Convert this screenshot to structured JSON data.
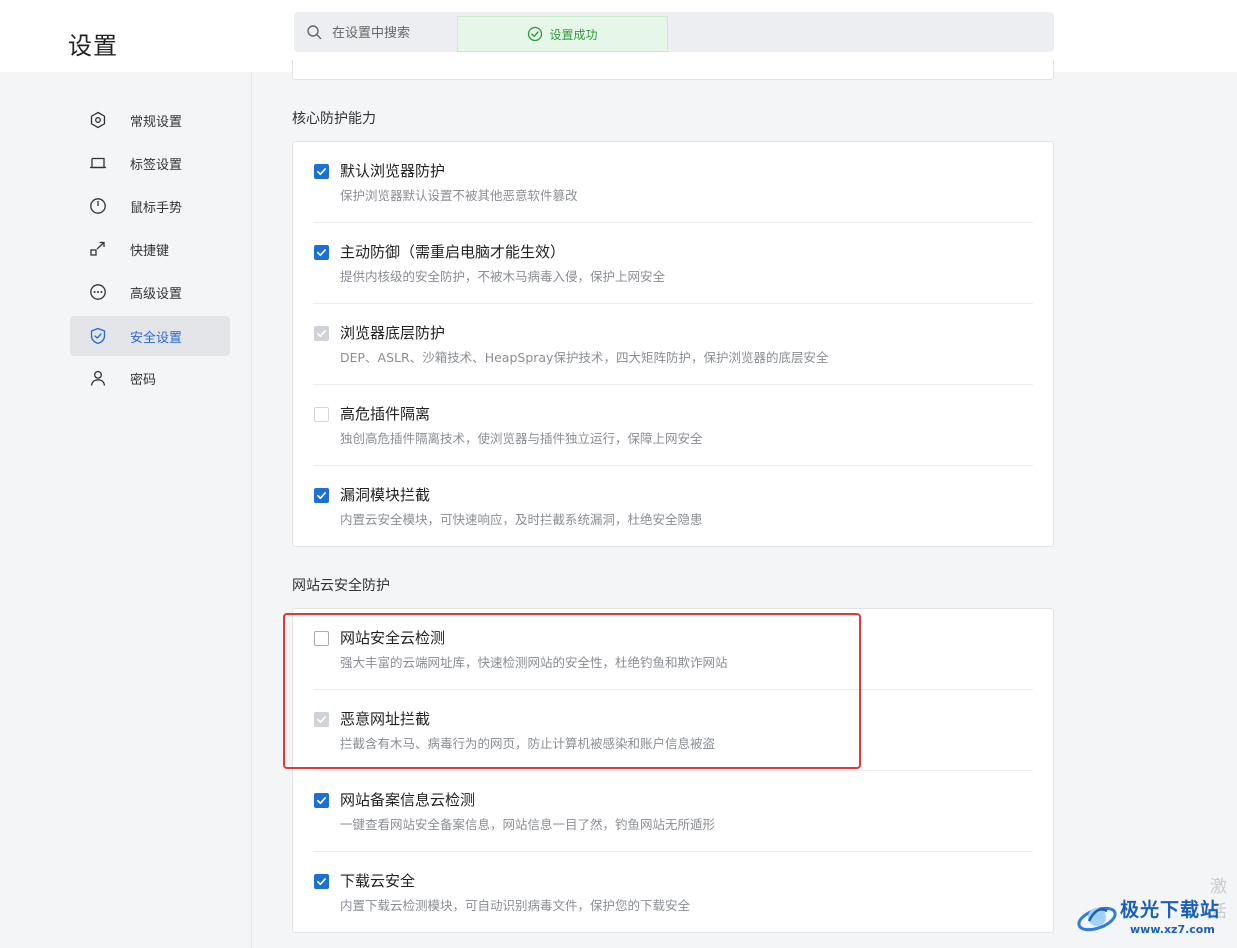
{
  "header": {
    "title": "设置",
    "search_placeholder": "在设置中搜索",
    "toast": "设置成功"
  },
  "sidebar": {
    "items": [
      {
        "label": "常规设置",
        "icon": "hexagon-gear-icon",
        "active": false
      },
      {
        "label": "标签设置",
        "icon": "tab-icon",
        "active": false
      },
      {
        "label": "鼠标手势",
        "icon": "mouse-icon",
        "active": false
      },
      {
        "label": "快捷键",
        "icon": "shortcut-arrow-icon",
        "active": false
      },
      {
        "label": "高级设置",
        "icon": "more-circle-icon",
        "active": false
      },
      {
        "label": "安全设置",
        "icon": "shield-icon",
        "active": true
      },
      {
        "label": "密码",
        "icon": "user-icon",
        "active": false
      }
    ]
  },
  "sections": [
    {
      "title": "核心防护能力",
      "options": [
        {
          "title": "默认浏览器防护",
          "desc": "保护浏览器默认设置不被其他恶意软件篡改",
          "state": "checked"
        },
        {
          "title": "主动防御（需重启电脑才能生效）",
          "desc": "提供内核级的安全防护，不被木马病毒入侵，保护上网安全",
          "state": "checked"
        },
        {
          "title": "浏览器底层防护",
          "desc": "DEP、ASLR、沙箱技术、HeapSpray保护技术，四大矩阵防护，保护浏览器的底层安全",
          "state": "disabled-checked"
        },
        {
          "title": "高危插件隔离",
          "desc": "独创高危插件隔离技术，使浏览器与插件独立运行，保障上网安全",
          "state": "unchecked-disabled"
        },
        {
          "title": "漏洞模块拦截",
          "desc": "内置云安全模块，可快速响应，及时拦截系统漏洞，杜绝安全隐患",
          "state": "checked"
        }
      ]
    },
    {
      "title": "网站云安全防护",
      "options": [
        {
          "title": "网站安全云检测",
          "desc": "强大丰富的云端网址库，快速检测网站的安全性，杜绝钓鱼和欺诈网站",
          "state": "unchecked"
        },
        {
          "title": "恶意网址拦截",
          "desc": "拦截含有木马、病毒行为的网页，防止计算机被感染和账户信息被盗",
          "state": "disabled-checked"
        },
        {
          "title": "网站备案信息云检测",
          "desc": "一键查看网站安全备案信息，网站信息一目了然，钓鱼网站无所遁形",
          "state": "checked"
        },
        {
          "title": "下载云安全",
          "desc": "内置下载云检测模块，可自动识别病毒文件，保护您的下载安全",
          "state": "checked"
        }
      ]
    }
  ],
  "watermark": {
    "text": "极光下载站",
    "url": "www.xz7.com",
    "ghost": "激活"
  },
  "colors": {
    "accent": "#1b6fd6",
    "highlight": "#e0393a",
    "toast_green": "#2e9a3a"
  }
}
